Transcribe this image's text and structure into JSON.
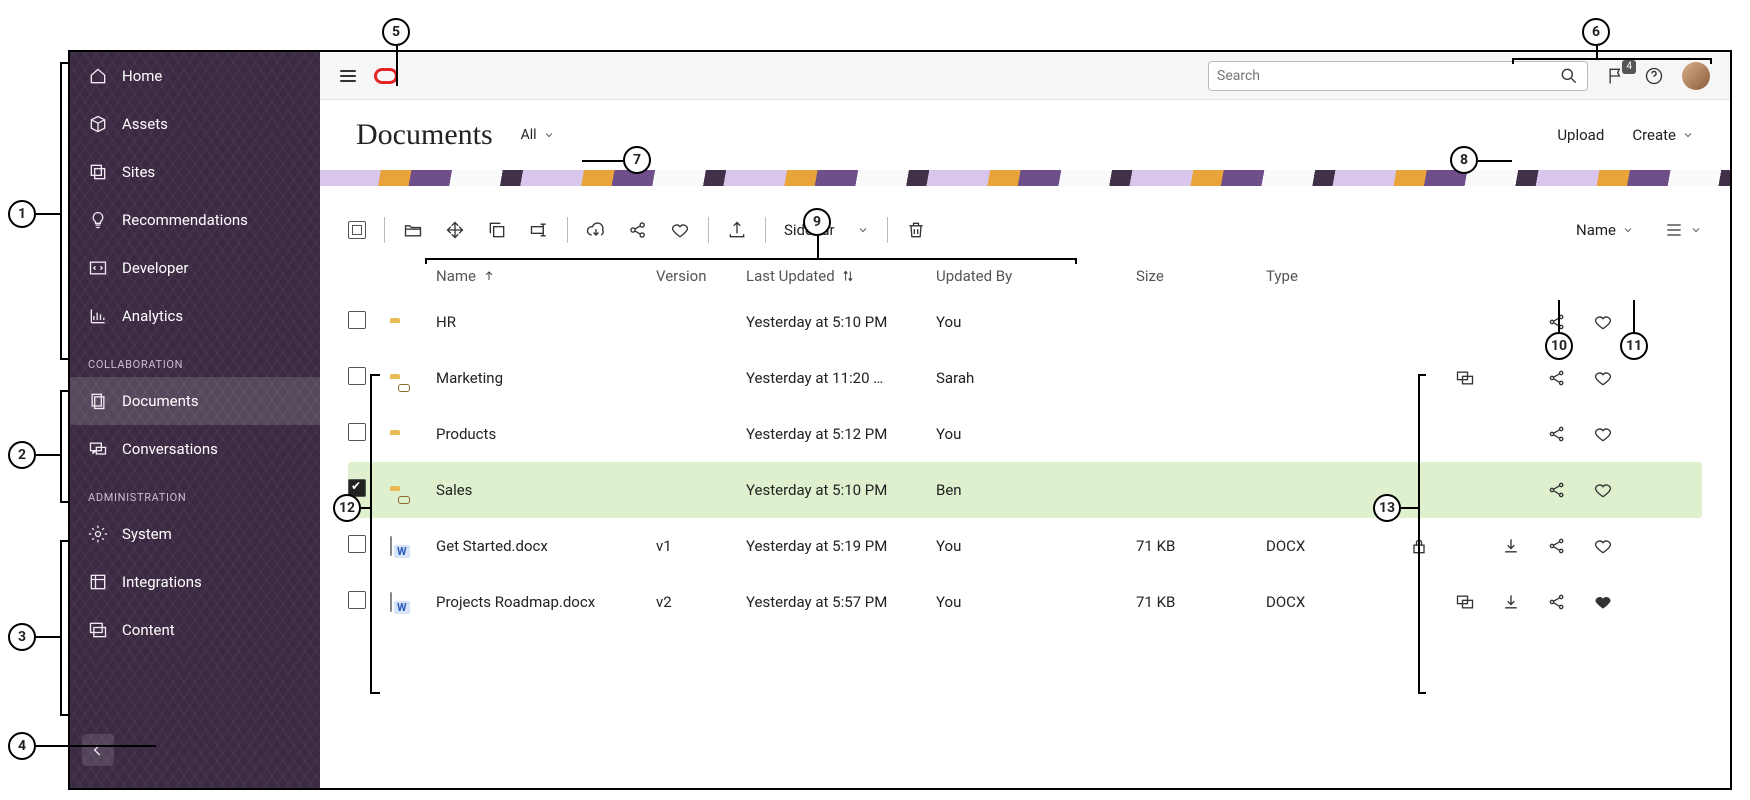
{
  "nav": {
    "main": [
      {
        "key": "home",
        "label": "Home",
        "icon": "home"
      },
      {
        "key": "assets",
        "label": "Assets",
        "icon": "cube"
      },
      {
        "key": "sites",
        "label": "Sites",
        "icon": "layers"
      },
      {
        "key": "recommendations",
        "label": "Recommendations",
        "icon": "bulb"
      },
      {
        "key": "developer",
        "label": "Developer",
        "icon": "code"
      },
      {
        "key": "analytics",
        "label": "Analytics",
        "icon": "chart"
      }
    ],
    "section_collab": "COLLABORATION",
    "collab": [
      {
        "key": "documents",
        "label": "Documents",
        "icon": "doc"
      },
      {
        "key": "conversations",
        "label": "Conversations",
        "icon": "chat"
      }
    ],
    "section_admin": "ADMINISTRATION",
    "admin": [
      {
        "key": "system",
        "label": "System",
        "icon": "gear"
      },
      {
        "key": "integrations",
        "label": "Integrations",
        "icon": "integ"
      },
      {
        "key": "content",
        "label": "Content",
        "icon": "content"
      }
    ],
    "selected": "documents"
  },
  "topbar": {
    "search_placeholder": "Search",
    "notifications": "4"
  },
  "page": {
    "title": "Documents",
    "filter": "All",
    "upload": "Upload",
    "create": "Create"
  },
  "actionbar": {
    "sidebar_label": "Sidebar",
    "sort_label": "Name"
  },
  "columns": {
    "name": "Name",
    "version": "Version",
    "updated": "Last Updated",
    "by": "Updated By",
    "size": "Size",
    "type": "Type"
  },
  "rows": [
    {
      "kind": "folder",
      "shared": false,
      "name": "HR",
      "version": "",
      "updated": "Yesterday at 5:10 PM",
      "by": "You",
      "size": "",
      "type": "",
      "selected": false,
      "chat": false,
      "lock": false,
      "download": false,
      "fav": false
    },
    {
      "kind": "folder",
      "shared": true,
      "name": "Marketing",
      "version": "",
      "updated": "Yesterday at 11:20 …",
      "by": "Sarah",
      "size": "",
      "type": "",
      "selected": false,
      "chat": true,
      "lock": false,
      "download": false,
      "fav": false
    },
    {
      "kind": "folder",
      "shared": false,
      "name": "Products",
      "version": "",
      "updated": "Yesterday at 5:12 PM",
      "by": "You",
      "size": "",
      "type": "",
      "selected": false,
      "chat": false,
      "lock": false,
      "download": false,
      "fav": false
    },
    {
      "kind": "folder",
      "shared": true,
      "name": "Sales",
      "version": "",
      "updated": "Yesterday at 5:10 PM",
      "by": "Ben",
      "size": "",
      "type": "",
      "selected": true,
      "chat": false,
      "lock": false,
      "download": false,
      "fav": false
    },
    {
      "kind": "file",
      "shared": false,
      "name": "Get Started.docx",
      "version": "v1",
      "updated": "Yesterday at 5:19 PM",
      "by": "You",
      "size": "71 KB",
      "type": "DOCX",
      "selected": false,
      "chat": false,
      "lock": true,
      "download": true,
      "fav": false
    },
    {
      "kind": "file",
      "shared": false,
      "name": "Projects Roadmap.docx",
      "version": "v2",
      "updated": "Yesterday at 5:57 PM",
      "by": "You",
      "size": "71 KB",
      "type": "DOCX",
      "selected": false,
      "chat": true,
      "lock": false,
      "download": true,
      "fav": true
    }
  ],
  "callouts": {
    "1": "1",
    "2": "2",
    "3": "3",
    "4": "4",
    "5": "5",
    "6": "6",
    "7": "7",
    "8": "8",
    "9": "9",
    "10": "10",
    "11": "11",
    "12": "12",
    "13": "13"
  }
}
